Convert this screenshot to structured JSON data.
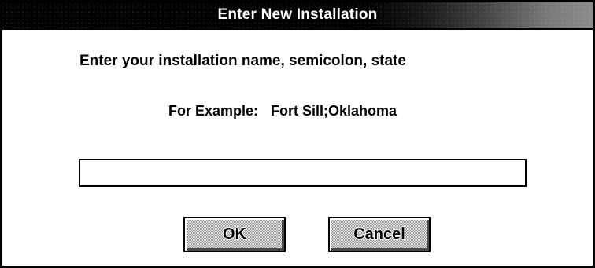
{
  "dialog": {
    "title": "Enter New Installation",
    "prompt": "Enter your installation name, semicolon, state",
    "example_label": "For Example:",
    "example_value": "Fort Sill;Oklahoma",
    "input_value": "",
    "buttons": {
      "ok_label": "OK",
      "cancel_label": "Cancel"
    }
  },
  "colors": {
    "titlebar": "#000000",
    "background": "#ffffff",
    "text": "#000000",
    "button_face": "#c0c0c0"
  }
}
